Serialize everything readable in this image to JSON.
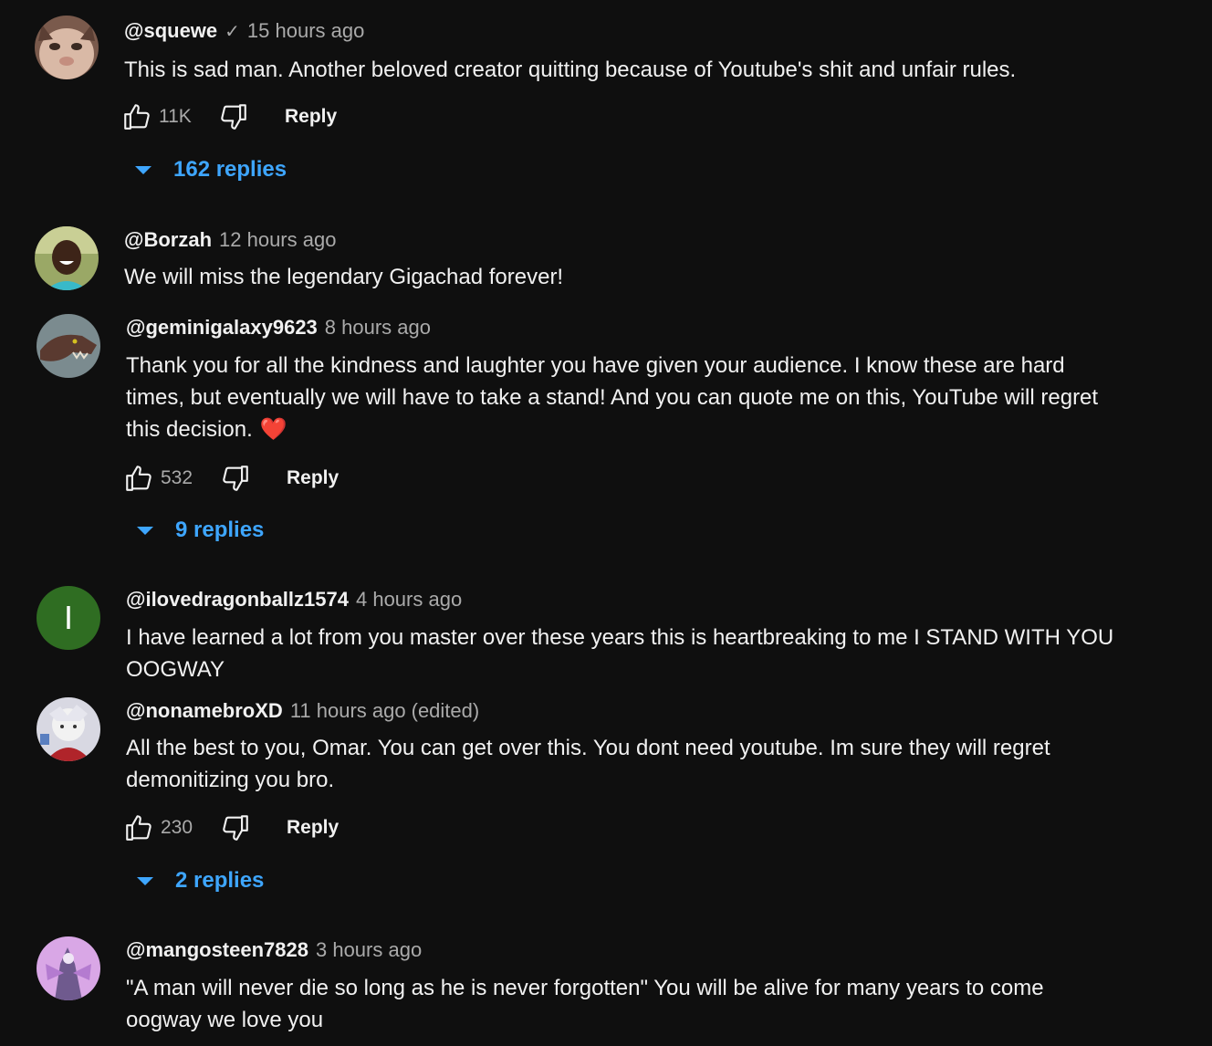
{
  "colors": {
    "background": "#0f0f0f",
    "text": "#f1f1f1",
    "secondary_text": "#aaaaaa",
    "link_blue": "#3ea6ff",
    "heart_red": "#e0262f"
  },
  "icons": {
    "like": "thumbs-up-icon",
    "dislike": "thumbs-down-icon",
    "verified": "checkmark-icon",
    "expand": "caret-down-icon"
  },
  "comments": [
    {
      "author": "@squewe",
      "verified_mark": "✓",
      "time": "15 hours ago",
      "text": "This is sad man. Another beloved creator quitting because of Youtube's shit and unfair rules.",
      "likes": "11K",
      "reply_label": "Reply",
      "replies": "162 replies"
    },
    {
      "author": "@Borzah",
      "time": "12 hours ago",
      "text": "We will miss the legendary Gigachad forever!"
    },
    {
      "author": "@geminigalaxy9623",
      "time": "8 hours ago",
      "text": "Thank you for all the kindness and laughter you have given your audience. I know these are hard times, but eventually we will have to take a stand! And you can quote me on this, YouTube will regret this decision.",
      "emoji": "❤️",
      "likes": "532",
      "reply_label": "Reply",
      "replies": "9 replies"
    },
    {
      "author": "@ilovedragonballz1574",
      "avatar_letter": "I",
      "time": "4 hours ago",
      "text": "I have learned a lot from you master over these years this is heartbreaking to me I STAND WITH YOU OOGWAY"
    },
    {
      "author": "@nonamebroXD",
      "time": "11 hours ago",
      "edited": "(edited)",
      "text": "All the best to you, Omar. You can get over this. You dont need youtube. Im sure they will regret demonitizing you bro.",
      "likes": "230",
      "reply_label": "Reply",
      "replies": "2 replies"
    },
    {
      "author": "@mangosteen7828",
      "time": "3 hours ago",
      "text": "\"A man will never die so long as he is never forgotten\" You will be alive for many years to come oogway we love you"
    }
  ]
}
